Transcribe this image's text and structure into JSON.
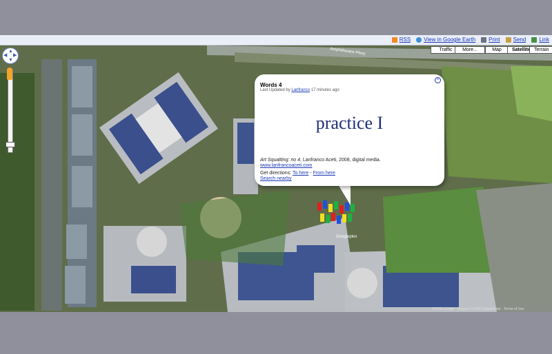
{
  "toolbar": {
    "rss": "RSS",
    "google_earth": "View in Google Earth",
    "print": "Print",
    "send": "Send",
    "link": "Link"
  },
  "map_controls": {
    "traffic": "Traffic",
    "more": "More...",
    "map": "Map",
    "satellite": "Satellite",
    "terrain": "Terrain",
    "selected": "Satellite"
  },
  "map_labels": {
    "road": "Amphitheatre Pkwy",
    "place": "Googleplex"
  },
  "info_window": {
    "title": "Words 4",
    "updated_prefix": "Last Updated by",
    "author": "Lanfranco",
    "updated_suffix": "17 minutes ago",
    "heading": "practice I",
    "caption_italic": "Art Squatting: no 4",
    "caption_rest": ", Lanfranco Aceti, 2008, digital media.",
    "url": "www.lanfrancoaceti.com",
    "directions_label": "Get directions:",
    "to_here": "To here",
    "from_here": "From here",
    "search_nearby": "Search nearby"
  },
  "copyright": "©2008 Google · Imagery ©2008 DigitalGlobe · Terms of Use",
  "icons": [
    "rss-icon",
    "earth-icon",
    "print-icon",
    "send-icon",
    "link-icon",
    "close-icon",
    "pan-control",
    "zoom-slider",
    "pegman-icon"
  ]
}
